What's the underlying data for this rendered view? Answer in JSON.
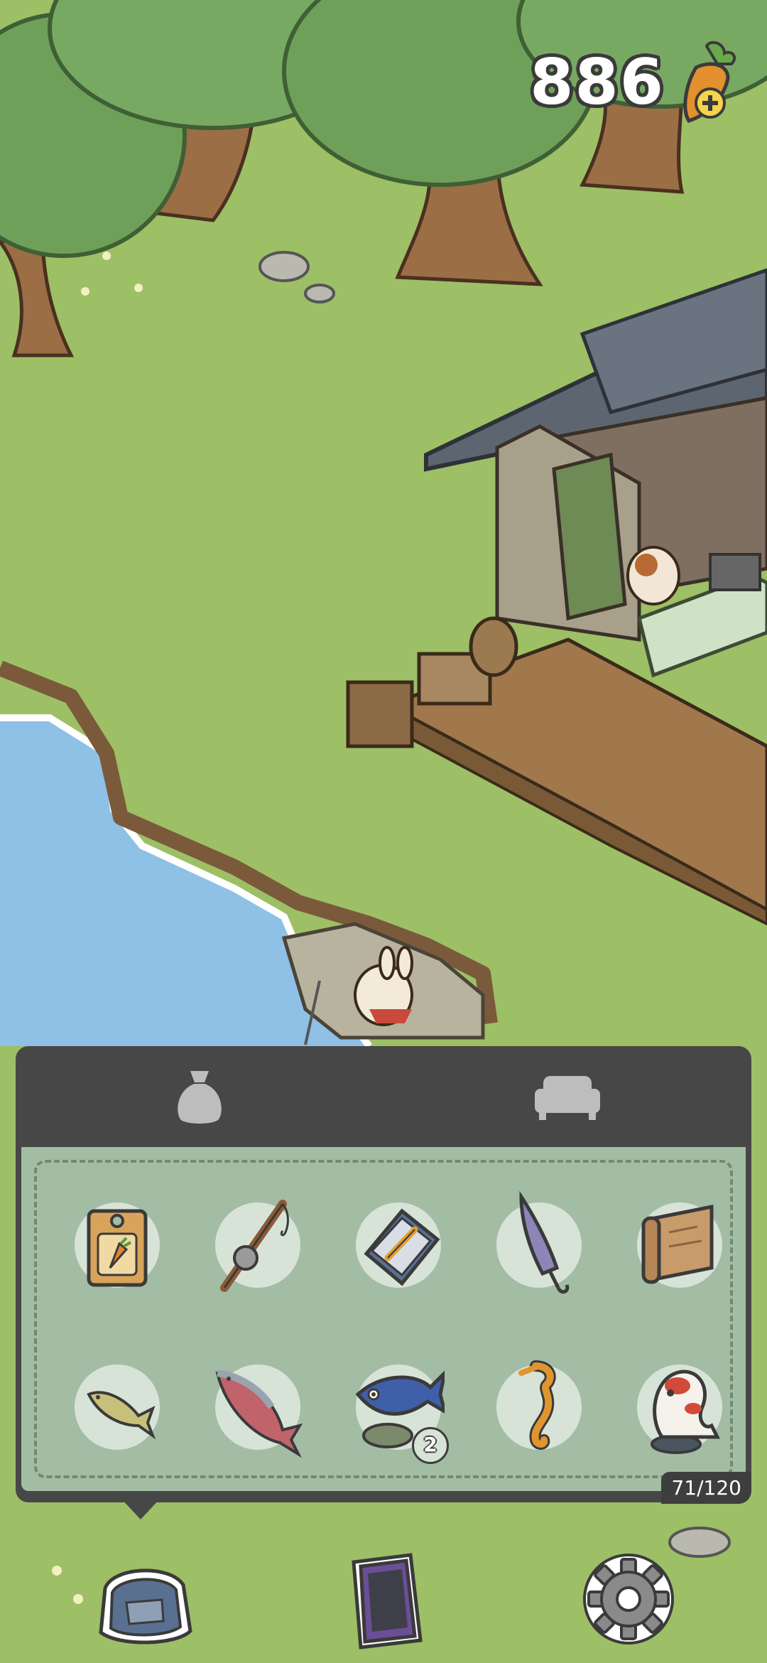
{
  "hud": {
    "currency_value": "886",
    "currency_icon": "carrot-plus-icon"
  },
  "inventory": {
    "tabs": [
      {
        "name": "bag",
        "icon": "sack-icon",
        "active": true
      },
      {
        "name": "furniture",
        "icon": "sofa-icon",
        "active": false
      }
    ],
    "capacity": "71/120",
    "items": [
      {
        "name": "carrot-seed-packet"
      },
      {
        "name": "fishing-rod"
      },
      {
        "name": "notebook-and-pencil"
      },
      {
        "name": "umbrella"
      },
      {
        "name": "map-scroll"
      },
      {
        "name": "small-fish"
      },
      {
        "name": "salmon"
      },
      {
        "name": "blue-fish-trophy",
        "count": "2"
      },
      {
        "name": "seahorse"
      },
      {
        "name": "koi-statue"
      }
    ]
  },
  "bottom_nav": [
    {
      "name": "backpack",
      "icon": "backpack-icon"
    },
    {
      "name": "phone",
      "icon": "phone-icon"
    },
    {
      "name": "settings",
      "icon": "gear-icon"
    }
  ],
  "colors": {
    "panel": "#474747",
    "grid": "#a3bda5",
    "grass": "#9dbf65",
    "water": "#8fc0e6"
  }
}
